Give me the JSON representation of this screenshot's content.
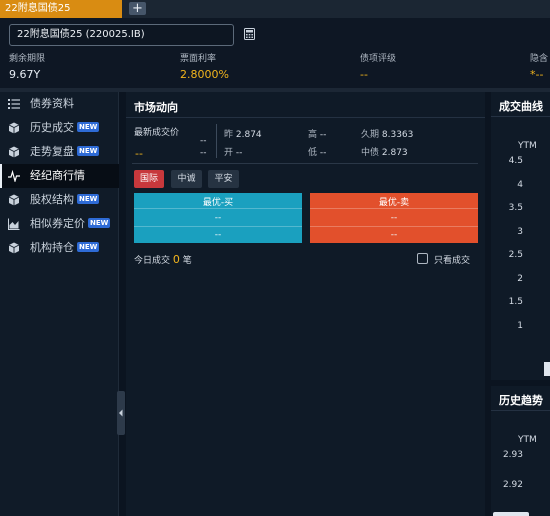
{
  "tab": {
    "title": "22附息国债25",
    "add_label": "+"
  },
  "header": {
    "search_value": "22附息国债25 (220025.IB)",
    "metrics": [
      {
        "label": "剩余期限",
        "value": "9.67Y"
      },
      {
        "label": "票面利率",
        "value": "2.8000%"
      },
      {
        "label": "债项评级",
        "value": "--"
      },
      {
        "label": "隐含",
        "value": "*--"
      }
    ]
  },
  "sidebar": {
    "items": [
      {
        "label": "债券资料",
        "badge": ""
      },
      {
        "label": "历史成交",
        "badge": "NEW"
      },
      {
        "label": "走势复盘",
        "badge": "NEW"
      },
      {
        "label": "经纪商行情",
        "badge": ""
      },
      {
        "label": "股权结构",
        "badge": "NEW"
      },
      {
        "label": "相似券定价",
        "badge": "NEW"
      },
      {
        "label": "机构持仓",
        "badge": "NEW"
      }
    ]
  },
  "market": {
    "title": "市场动向",
    "last_price_label": "最新成交价",
    "last_price_dash": "--",
    "last_price_change": "--",
    "last_price_change2": "--",
    "prev_label": "昨",
    "prev_value": "2.874",
    "open_label": "开",
    "open_value": "--",
    "high_label": "高",
    "high_value": "--",
    "low_label": "低",
    "low_value": "--",
    "duration_label": "久期",
    "duration_value": "8.3363",
    "cb_label": "中债",
    "cb_value": "2.873",
    "sources": [
      "国际",
      "中诚",
      "平安"
    ],
    "buy": {
      "title": "最优-买",
      "v1": "--",
      "v2": "--"
    },
    "sell": {
      "title": "最优-卖",
      "v1": "--",
      "v2": "--"
    },
    "today_label": "今日成交",
    "today_count": "0",
    "today_unit": "笔",
    "only_trades_label": "只看成交"
  },
  "trade_curve": {
    "title": "成交曲线",
    "chart_data": {
      "type": "line",
      "ylabel": "YTM",
      "yticks": [
        "4.5",
        "4",
        "3.5",
        "3",
        "2.5",
        "2",
        "1.5",
        "1"
      ],
      "ylim": [
        1,
        4.5
      ],
      "series": []
    }
  },
  "history_trend": {
    "title": "历史趋势",
    "chart_data": {
      "type": "line",
      "ylabel": "YTM",
      "yticks": [
        "2.93",
        "2.92"
      ],
      "series": []
    }
  },
  "colors": {
    "tab_active": "#d98c12",
    "buy": "#1aa0bf",
    "sell": "#e2502c",
    "source_active": "#c7383c",
    "coupon_value": "#f2b51d",
    "new_badge": "#2e6bd6"
  }
}
